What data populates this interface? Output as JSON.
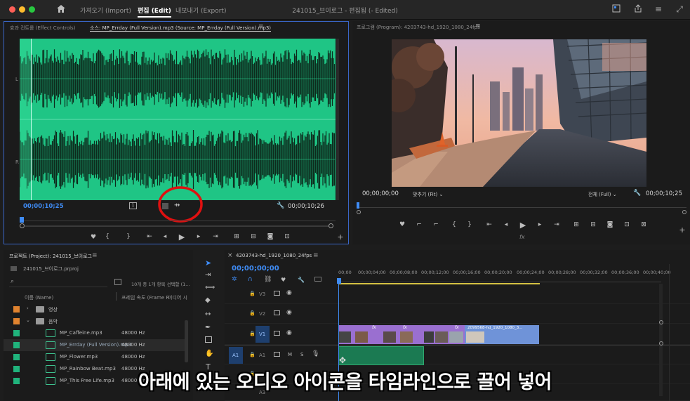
{
  "window": {
    "menu": {
      "import": "가져오기 (Import)",
      "edit": "편집 (Edit)",
      "export": "내보내기 (Export)"
    },
    "title": "241015_브이로그 - 편집됨 (- Edited)"
  },
  "source": {
    "tab_effect": "효과 컨트롤 (Effect Controls)",
    "tab_source": "소스: MP_Errday (Full Version).mp3 (Source: MP_Errday (Full Version).mp3)",
    "channel_l": "L",
    "channel_r": "R",
    "timecode_in": "00;00;10;25",
    "timecode_dur": "00;00;10;26"
  },
  "program": {
    "tab": "프로그램 (Program): 4203743-hd_1920_1080_24fps",
    "timecode": "00;00;00;00",
    "fit_label": "맞추기 (Fit)",
    "quality_label": "전체 (Full)",
    "timecode_end": "00;00;10;25"
  },
  "project": {
    "tab": "프로젝트 (Project): 241015_브이로그",
    "file": "241015_브이로그.prproj",
    "selection_info": "10개 중 1개 항목 선택함 (1...",
    "col_name": "이름 (Name)",
    "col_fps": "프레임 속도 (Frame R",
    "col_media": "미디어 시",
    "folders": [
      {
        "name": "영상",
        "color": "#e0832f"
      },
      {
        "name": "음악",
        "color": "#e0832f"
      }
    ],
    "items": [
      {
        "name": "MP_Caffeine.mp3",
        "rate": "48000 Hz",
        "color": "#20b37c"
      },
      {
        "name": "MP_Errday (Full Version).mp3",
        "rate": "48000 Hz",
        "color": "#20b37c"
      },
      {
        "name": "MP_Flower.mp3",
        "rate": "48000 Hz",
        "color": "#20b37c"
      },
      {
        "name": "MP_Rainbow Beat.mp3",
        "rate": "48000 Hz",
        "color": "#20b37c"
      },
      {
        "name": "MP_This Free Life.mp3",
        "rate": "48000 Hz",
        "color": "#20b37c"
      }
    ]
  },
  "timeline": {
    "tab": "4203743-hd_1920_1080_24fps",
    "timecode": "00;00;00;00",
    "ruler": [
      "00;00",
      "00;00;04;00",
      "00;00;08;00",
      "00;00;12;00",
      "00;00;16;00",
      "00;00;20;00",
      "00;00;24;00",
      "00;00;28;00",
      "00;00;32;00",
      "00;00;36;00",
      "00;00;40;00"
    ],
    "tracks": {
      "v3": "V3",
      "v2": "V2",
      "v1": "V1",
      "a1_src": "A1",
      "a1": "A1",
      "a2": "A2",
      "a3": "A3"
    },
    "clip_label": "2099568-hd_1920_1080_3...",
    "fx": "fx",
    "m": "M",
    "s": "S"
  },
  "subtitle": "아래에 있는 오디오 아이콘을 타임라인으로 끌어 넣어",
  "colors": {
    "waveform": "#1fc585",
    "accent_blue": "#3f8cf5",
    "highlight_red": "#e01010",
    "clip_blue": "#6f93d8",
    "clip_purple": "#9a6fd0",
    "audio_clip": "#1b7a52"
  }
}
